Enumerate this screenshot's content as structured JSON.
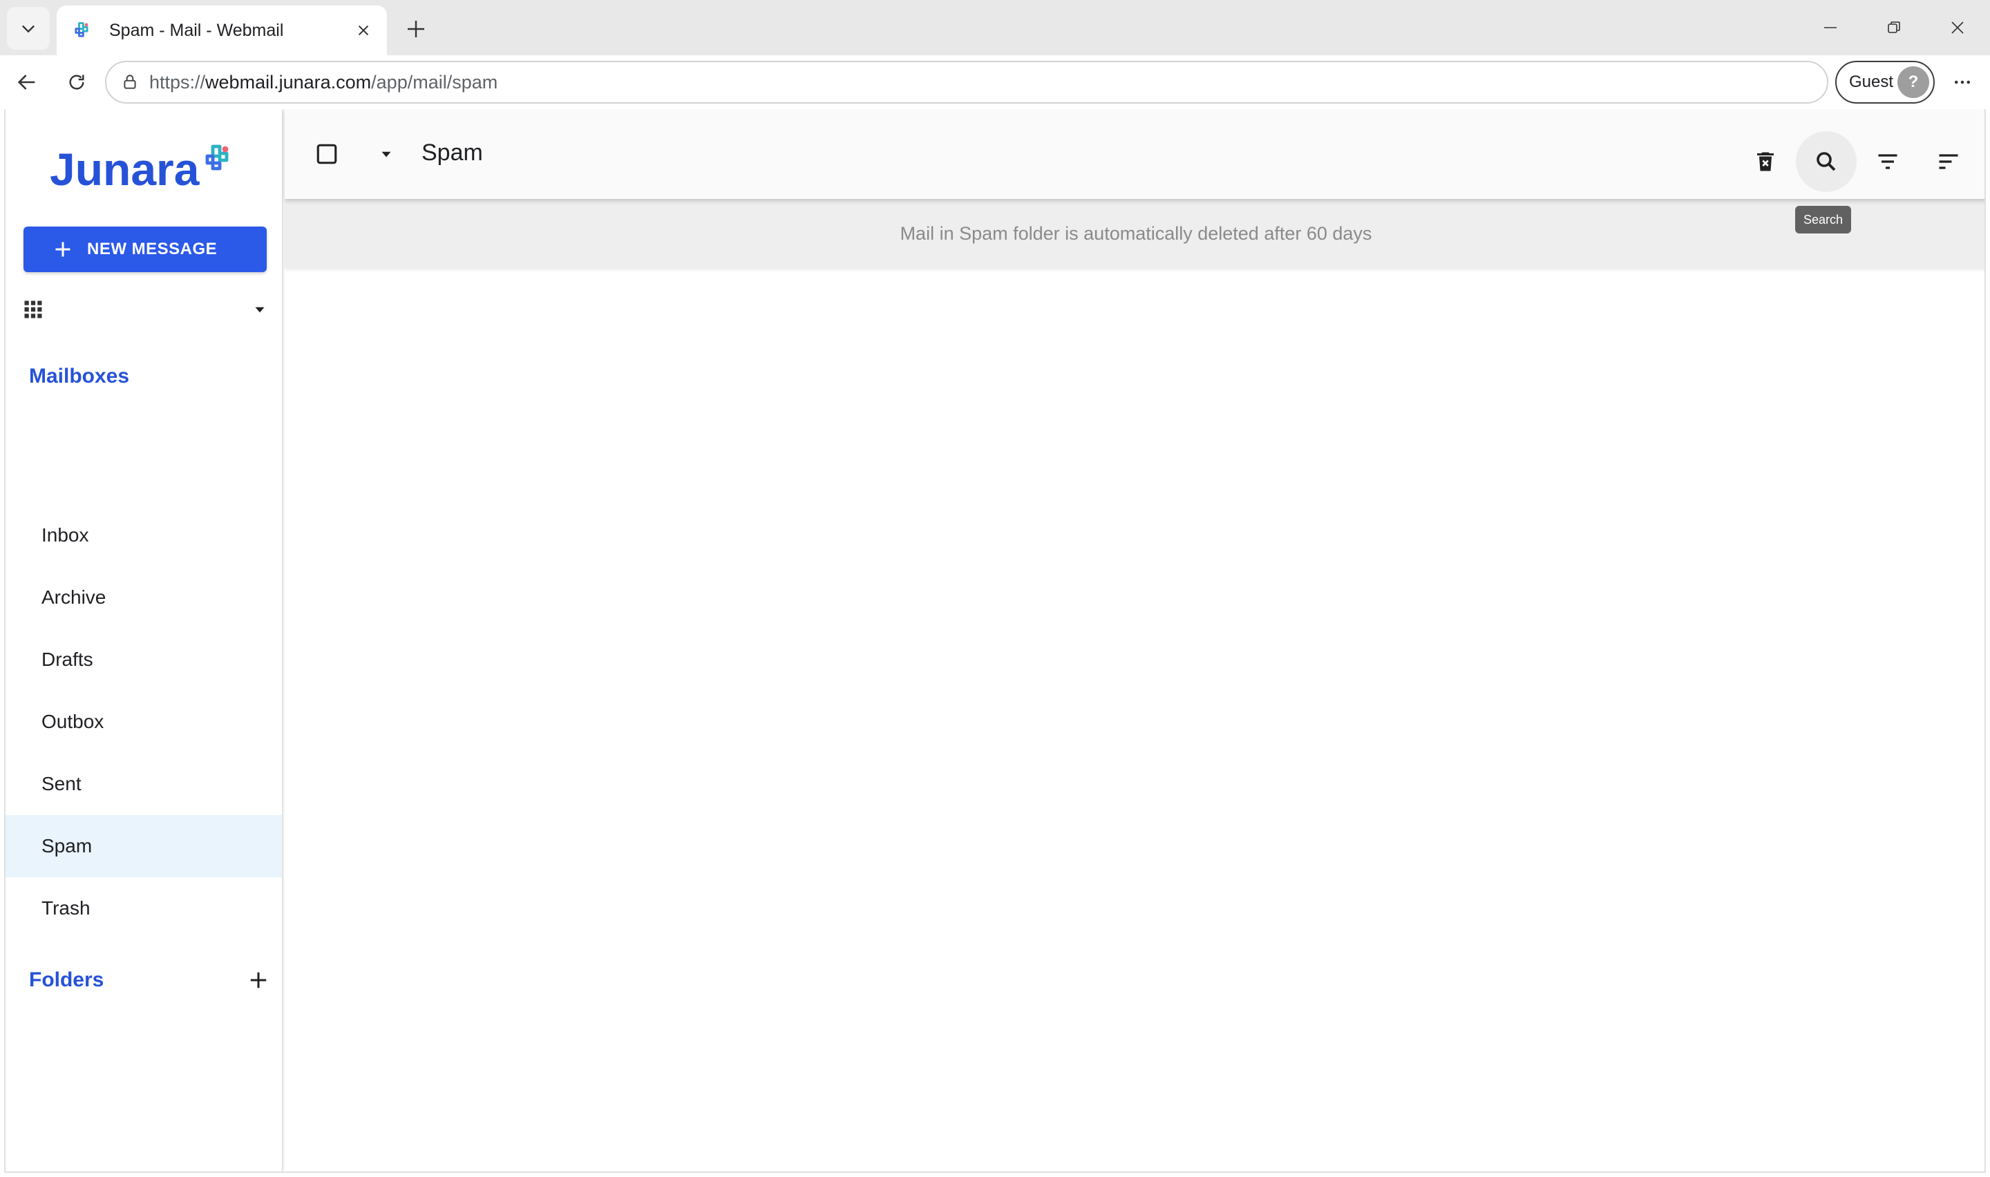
{
  "browser": {
    "tab_title": "Spam - Mail - Webmail",
    "url_scheme": "https://",
    "url_host": "webmail.junara.com",
    "url_path": "/app/mail/spam",
    "profile_label": "Guest",
    "profile_avatar_glyph": "?"
  },
  "app": {
    "logo_text": "Junara",
    "compose_label": "NEW MESSAGE",
    "mailboxes_title": "Mailboxes",
    "mailboxes": [
      {
        "label": "Inbox"
      },
      {
        "label": "Archive"
      },
      {
        "label": "Drafts"
      },
      {
        "label": "Outbox"
      },
      {
        "label": "Sent"
      },
      {
        "label": "Spam"
      },
      {
        "label": "Trash"
      }
    ],
    "active_mailbox": "Spam",
    "folders_title": "Folders"
  },
  "main": {
    "folder_title": "Spam",
    "tooltip": "Search",
    "notice": "Mail in Spam folder is automatically deleted after 60 days"
  },
  "colors": {
    "brand_blue": "#2652d8",
    "compose_blue": "#2b59e8",
    "active_item_bg": "#e9f4fc"
  }
}
